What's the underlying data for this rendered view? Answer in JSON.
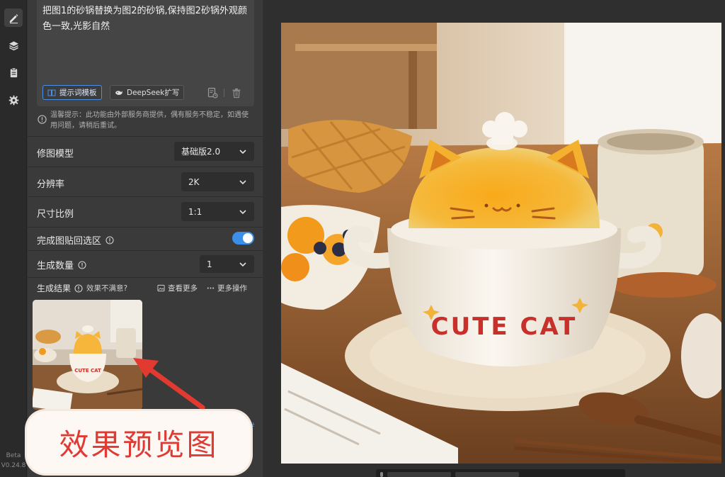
{
  "rail": {
    "items": [
      {
        "name": "edit",
        "icon": "pencil-icon",
        "active": true
      },
      {
        "name": "layers",
        "icon": "layers-icon",
        "active": false
      },
      {
        "name": "notes",
        "icon": "clipboard-icon",
        "active": false
      },
      {
        "name": "settings",
        "icon": "gear-icon",
        "active": false
      }
    ],
    "version_label": "Beta",
    "version_number": "V0.24.8"
  },
  "prompt": {
    "text": "把图1的砂锅替换为图2的砂锅,保持图2砂锅外观颜色一致,光影自然",
    "template_button": "提示词模板",
    "deepseek_button": "DeepSeek扩写"
  },
  "notice": "温馨提示：此功能由外部服务商提供，偶有服务不稳定，如遇使用问题，请稍后重试。",
  "settings": {
    "model": {
      "label": "修图模型",
      "value": "基础版2.0"
    },
    "resolution": {
      "label": "分辨率",
      "value": "2K"
    },
    "ratio": {
      "label": "尺寸比例",
      "value": "1:1"
    },
    "paste_back": {
      "label": "完成图贴回选区",
      "enabled": true
    },
    "count": {
      "label": "生成数量",
      "value": "1"
    }
  },
  "results": {
    "label": "生成结果",
    "unsatisfied": "效果不满意?",
    "view_more": "查看更多",
    "more_actions": "更多操作",
    "overlay_caption": "效果预览图"
  },
  "product": {
    "text": "CUTE CAT"
  },
  "colors": {
    "accent": "#3b8fe8",
    "caption_red": "#e03a34",
    "panel_bg": "#3a3a3a"
  }
}
